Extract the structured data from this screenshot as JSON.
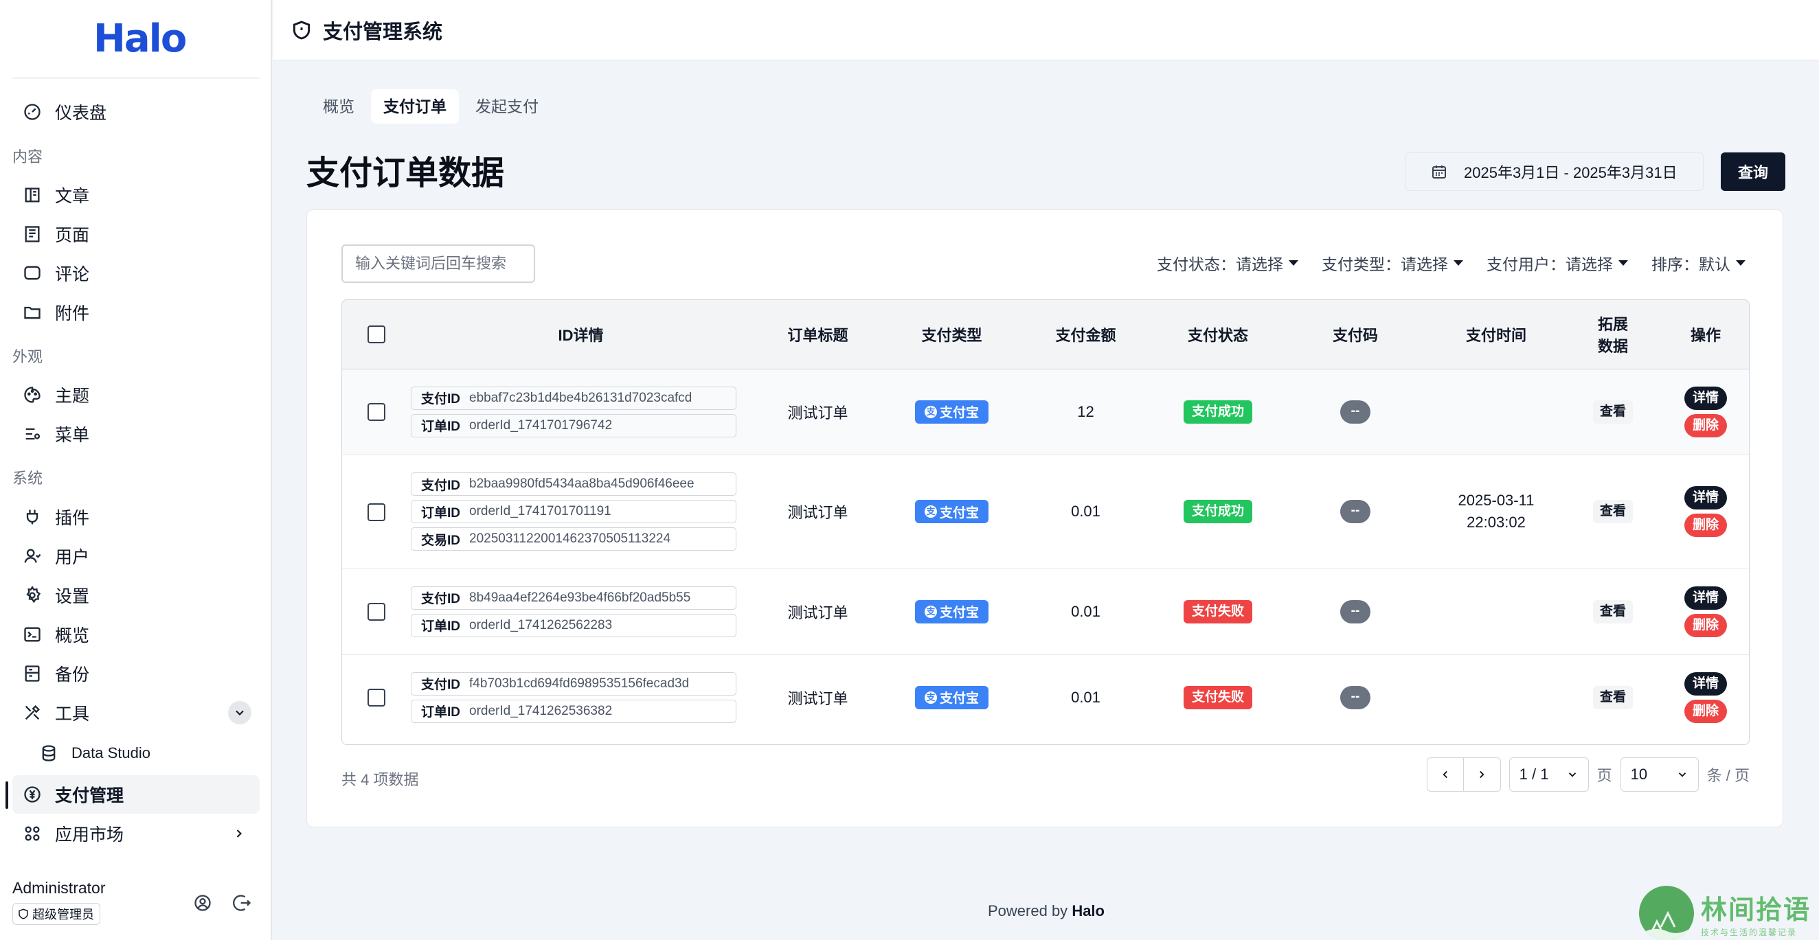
{
  "sidebar": {
    "logo": "Halo",
    "items": [
      {
        "label": "仪表盘",
        "icon": "dashboard-icon"
      },
      {
        "label": "文章",
        "icon": "book-icon"
      },
      {
        "label": "页面",
        "icon": "page-icon"
      },
      {
        "label": "评论",
        "icon": "comment-icon"
      },
      {
        "label": "附件",
        "icon": "folder-icon"
      },
      {
        "label": "主题",
        "icon": "palette-icon"
      },
      {
        "label": "菜单",
        "icon": "menu-icon"
      },
      {
        "label": "插件",
        "icon": "plug-icon"
      },
      {
        "label": "用户",
        "icon": "user-icon"
      },
      {
        "label": "设置",
        "icon": "gear-icon"
      },
      {
        "label": "概览",
        "icon": "terminal-icon"
      },
      {
        "label": "备份",
        "icon": "backup-icon"
      },
      {
        "label": "工具",
        "icon": "tools-icon"
      },
      {
        "label": "Data Studio",
        "icon": "database-icon"
      },
      {
        "label": "支付管理",
        "icon": "payment-icon"
      },
      {
        "label": "应用市场",
        "icon": "apps-icon"
      }
    ],
    "sections": {
      "content": "内容",
      "appearance": "外观",
      "system": "系统"
    },
    "user": {
      "name": "Administrator",
      "role": "超级管理员"
    }
  },
  "header": {
    "title": "支付管理系统",
    "icon": "shield-icon"
  },
  "tabs": [
    {
      "label": "概览",
      "active": false
    },
    {
      "label": "支付订单",
      "active": true
    },
    {
      "label": "发起支付",
      "active": false
    }
  ],
  "page_title": "支付订单数据",
  "date_range": "2025年3月1日 - 2025年3月31日",
  "query_label": "查询",
  "search": {
    "placeholder": "输入关键词后回车搜索",
    "value": ""
  },
  "filters": [
    {
      "label": "支付状态：请选择"
    },
    {
      "label": "支付类型：请选择"
    },
    {
      "label": "支付用户：请选择"
    },
    {
      "label": "排序：默认"
    }
  ],
  "table": {
    "headers": [
      "ID详情",
      "订单标题",
      "支付类型",
      "支付金额",
      "支付状态",
      "支付码",
      "支付时间",
      "拓展数据",
      "操作"
    ],
    "header_ext_line1": "拓展",
    "header_ext_line2": "数据",
    "rows": [
      {
        "ids": [
          {
            "k": "支付ID",
            "v": "ebbaf7c23b1d4be4b26131d7023cafcd"
          },
          {
            "k": "订单ID",
            "v": "orderId_1741701796742"
          }
        ],
        "title": "测试订单",
        "type": "支付宝",
        "amount": "12",
        "status": "支付成功",
        "status_kind": "ok",
        "code": "--",
        "time_date": "",
        "time_clock": "",
        "view": "查看",
        "detail": "详情",
        "delete": "删除"
      },
      {
        "ids": [
          {
            "k": "支付ID",
            "v": "b2baa9980fd5434aa8ba45d906f46eee"
          },
          {
            "k": "订单ID",
            "v": "orderId_1741701701191"
          },
          {
            "k": "交易ID",
            "v": "2025031122001462370505113224"
          }
        ],
        "title": "测试订单",
        "type": "支付宝",
        "amount": "0.01",
        "status": "支付成功",
        "status_kind": "ok",
        "code": "--",
        "time_date": "2025-03-11",
        "time_clock": "22:03:02",
        "view": "查看",
        "detail": "详情",
        "delete": "删除"
      },
      {
        "ids": [
          {
            "k": "支付ID",
            "v": "8b49aa4ef2264e93be4f66bf20ad5b55"
          },
          {
            "k": "订单ID",
            "v": "orderId_1741262562283"
          }
        ],
        "title": "测试订单",
        "type": "支付宝",
        "amount": "0.01",
        "status": "支付失败",
        "status_kind": "fail",
        "code": "--",
        "time_date": "",
        "time_clock": "",
        "view": "查看",
        "detail": "详情",
        "delete": "删除"
      },
      {
        "ids": [
          {
            "k": "支付ID",
            "v": "f4b703b1cd694fd6989535156fecad3d"
          },
          {
            "k": "订单ID",
            "v": "orderId_1741262536382"
          }
        ],
        "title": "测试订单",
        "type": "支付宝",
        "amount": "0.01",
        "status": "支付失败",
        "status_kind": "fail",
        "code": "--",
        "time_date": "",
        "time_clock": "",
        "view": "查看",
        "detail": "详情",
        "delete": "删除"
      }
    ]
  },
  "pagination": {
    "total_text": "共 4 项数据",
    "page_value": "1 / 1",
    "page_unit": "页",
    "size_value": "10",
    "size_unit": "条 / 页"
  },
  "footer": {
    "prefix": "Powered by",
    "brand": "Halo"
  },
  "watermark": {
    "main": "林间拾语",
    "sub": "技术与生活的温馨记录"
  },
  "colors": {
    "accent": "#1d4ed8",
    "success": "#22c55e",
    "danger": "#ef4444",
    "alipay": "#3b82f6",
    "dark": "#0f172a"
  }
}
